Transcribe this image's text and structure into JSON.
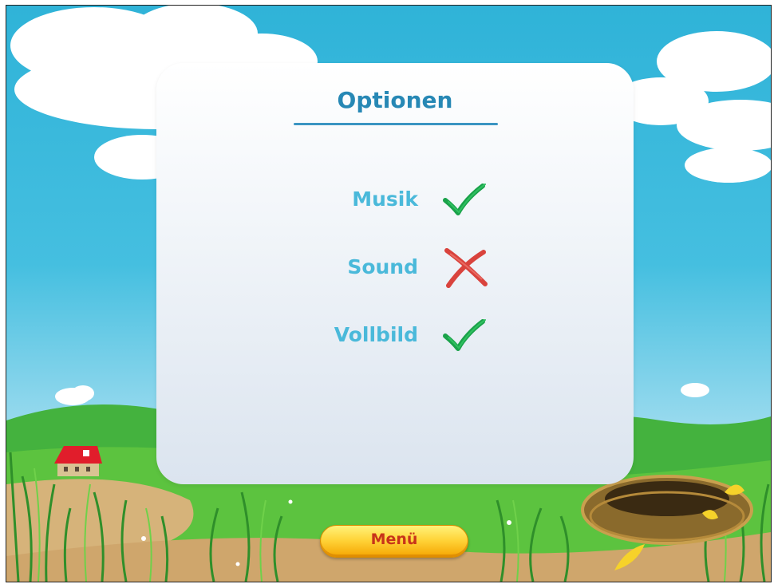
{
  "options": {
    "title": "Optionen",
    "items": [
      {
        "label": "Musik",
        "enabled": true
      },
      {
        "label": "Sound",
        "enabled": false
      },
      {
        "label": "Vollbild",
        "enabled": true
      }
    ]
  },
  "menu_button": {
    "label": "Menü"
  },
  "icons": {
    "check": "checkmark-icon",
    "cross": "cross-icon"
  },
  "colors": {
    "sky": "#2fb3d8",
    "title": "#2788b5",
    "option_label": "#4ab9da",
    "check": "#1aa24a",
    "cross": "#d9433d",
    "button": "#ffd43a",
    "button_text": "#c8341a"
  }
}
